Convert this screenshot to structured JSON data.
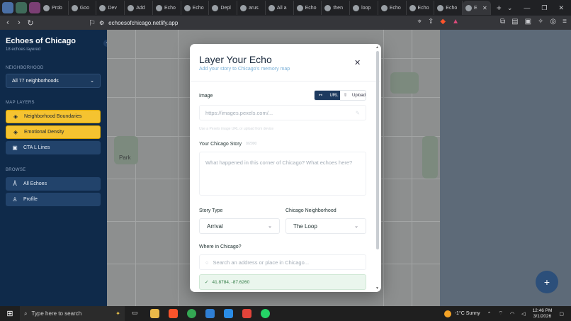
{
  "browser": {
    "tabs": [
      {
        "label": "Prob",
        "active": false
      },
      {
        "label": "Goo",
        "active": false
      },
      {
        "label": "Dev",
        "active": false
      },
      {
        "label": "Add",
        "active": false
      },
      {
        "label": "Echo",
        "active": false
      },
      {
        "label": "Echo",
        "active": false
      },
      {
        "label": "Depl",
        "active": false
      },
      {
        "label": "arus",
        "active": false
      },
      {
        "label": "All a",
        "active": false
      },
      {
        "label": "Echo",
        "active": false
      },
      {
        "label": "then",
        "active": false
      },
      {
        "label": "loop",
        "active": false
      },
      {
        "label": "Echo",
        "active": false
      },
      {
        "label": "Echo",
        "active": false
      },
      {
        "label": "Echo",
        "active": false
      },
      {
        "label": "E",
        "active": true
      }
    ],
    "url": "echoesofchicago.netlify.app"
  },
  "sidebar": {
    "title": "Echoes of Chicago",
    "subtitle": "18 echoes layered",
    "neighborhood_label": "NEIGHBORHOOD",
    "neighborhood_value": "All 77 neighborhoods",
    "map_layers_label": "MAP LAYERS",
    "layers": [
      {
        "label": "Neighborhood Boundaries",
        "active": true
      },
      {
        "label": "Emotional Density",
        "active": true
      },
      {
        "label": "CTA L Lines",
        "active": false
      }
    ],
    "browse_label": "BROWSE",
    "browse": [
      {
        "label": "All Echoes"
      },
      {
        "label": "Profile"
      }
    ]
  },
  "map": {
    "label": "Park"
  },
  "modal": {
    "title": "Layer Your Echo",
    "subtitle": "Add your story to Chicago's memory map",
    "image_label": "Image",
    "url_tab": "URL",
    "upload_tab": "Upload",
    "image_placeholder": "https://images.pexels.com/...",
    "image_hint": "Use a Pexels image URL or upload from device",
    "story_label": "Your Chicago Story",
    "story_counter": "0/2000",
    "story_placeholder": "What happened in this corner of Chicago? What echoes here?",
    "type_label": "Story Type",
    "type_value": "Arrival",
    "neighborhood_label": "Chicago Neighborhood",
    "neighborhood_value": "The Loop",
    "where_label": "Where in Chicago?",
    "where_placeholder": "Search an address or place in Chicago...",
    "coords": "41.8784, -87.6260"
  },
  "taskbar": {
    "search_placeholder": "Type here to search",
    "weather": "-1°C  Sunny",
    "time": "12:46 PM",
    "date": "3/1/2026"
  },
  "colors": {
    "sidebar_bg": "#0f2a4a",
    "accent_gold": "#f5c330",
    "accent_blue": "#1d3a5f",
    "success_green": "#2f7a43"
  }
}
